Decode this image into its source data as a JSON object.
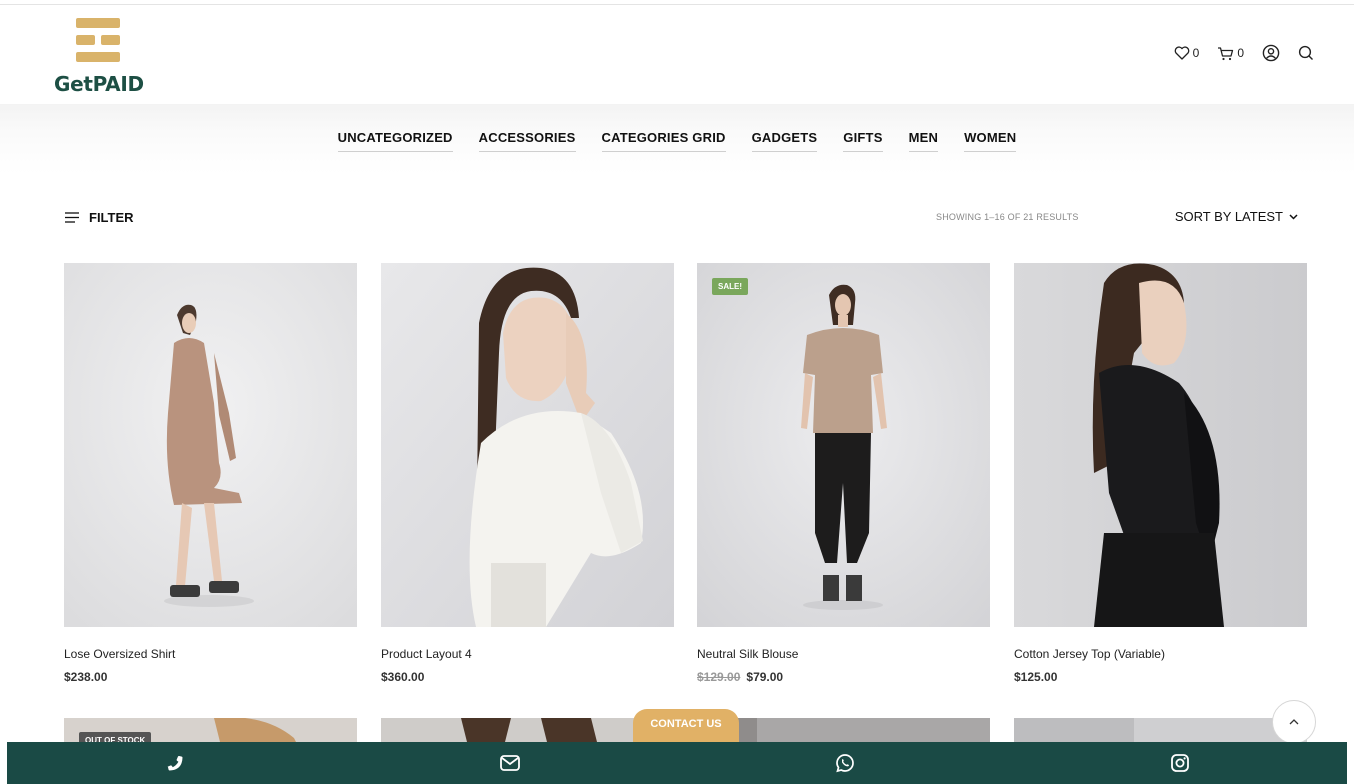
{
  "brand": {
    "name": "GetPAID"
  },
  "header": {
    "wishlist_count": "0",
    "cart_count": "0"
  },
  "nav": {
    "items": [
      "UNCATEGORIZED",
      "ACCESSORIES",
      "CATEGORIES GRID",
      "GADGETS",
      "GIFTS",
      "MEN",
      "WOMEN"
    ]
  },
  "toolbar": {
    "filter_label": "FILTER",
    "results_text": "SHOWING 1–16 OF 21 RESULTS",
    "sort_label": "SORT BY LATEST"
  },
  "products": [
    {
      "title": "Lose Oversized Shirt",
      "price": "$238.00"
    },
    {
      "title": "Product Layout 4",
      "price": "$360.00"
    },
    {
      "title": "Neutral Silk Blouse",
      "old_price": "$129.00",
      "price": "$79.00",
      "badge": "SALE!"
    },
    {
      "title": "Cotton Jersey Top (Variable)",
      "price": "$125.00"
    }
  ],
  "row2": {
    "badge": "OUT OF STOCK"
  },
  "contact": {
    "label": "CONTACT US"
  },
  "bottom_bar": {
    "icons": [
      "phone-icon",
      "mail-icon",
      "whatsapp-icon",
      "instagram-icon"
    ]
  },
  "colors": {
    "brand_green": "#1d4f44",
    "brand_gold": "#d9b36a",
    "bottom_bar": "#1a4a45",
    "contact_tab": "#e1b166",
    "sale_badge": "#7aa75c"
  }
}
